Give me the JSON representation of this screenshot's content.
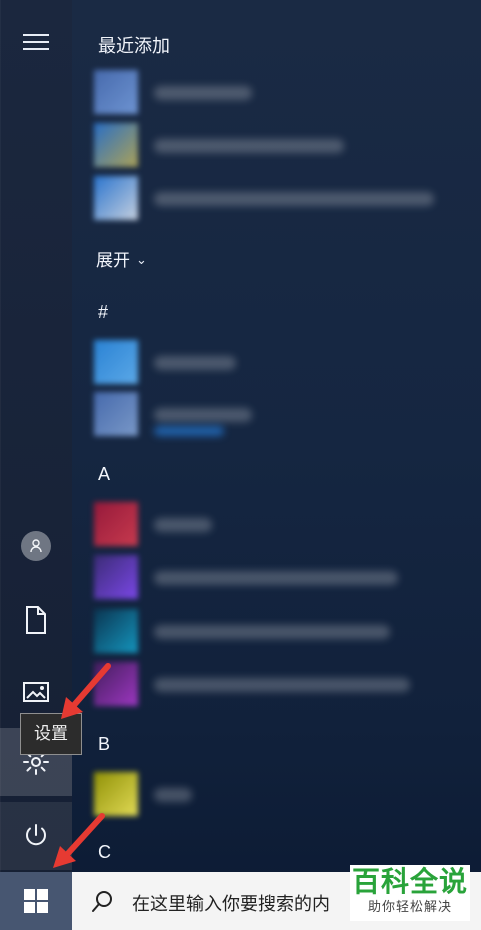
{
  "start_menu": {
    "section_recent": "最近添加",
    "expand_label": "展开",
    "letters": [
      "#",
      "A",
      "B",
      "C"
    ],
    "tooltip": "设置"
  },
  "taskbar": {
    "search_text": "在这里输入你要搜索的内"
  },
  "watermark": {
    "main": "百科全说",
    "sub": "助你轻松解决"
  },
  "colors": {
    "accent_red": "#e63a32",
    "brand_green": "#29a33a"
  },
  "icons": {
    "menu": "hamburger-icon",
    "user": "user-icon",
    "documents": "document-icon",
    "pictures": "image-icon",
    "settings": "gear-icon",
    "power": "power-icon",
    "start": "windows-icon",
    "search": "search-icon"
  }
}
